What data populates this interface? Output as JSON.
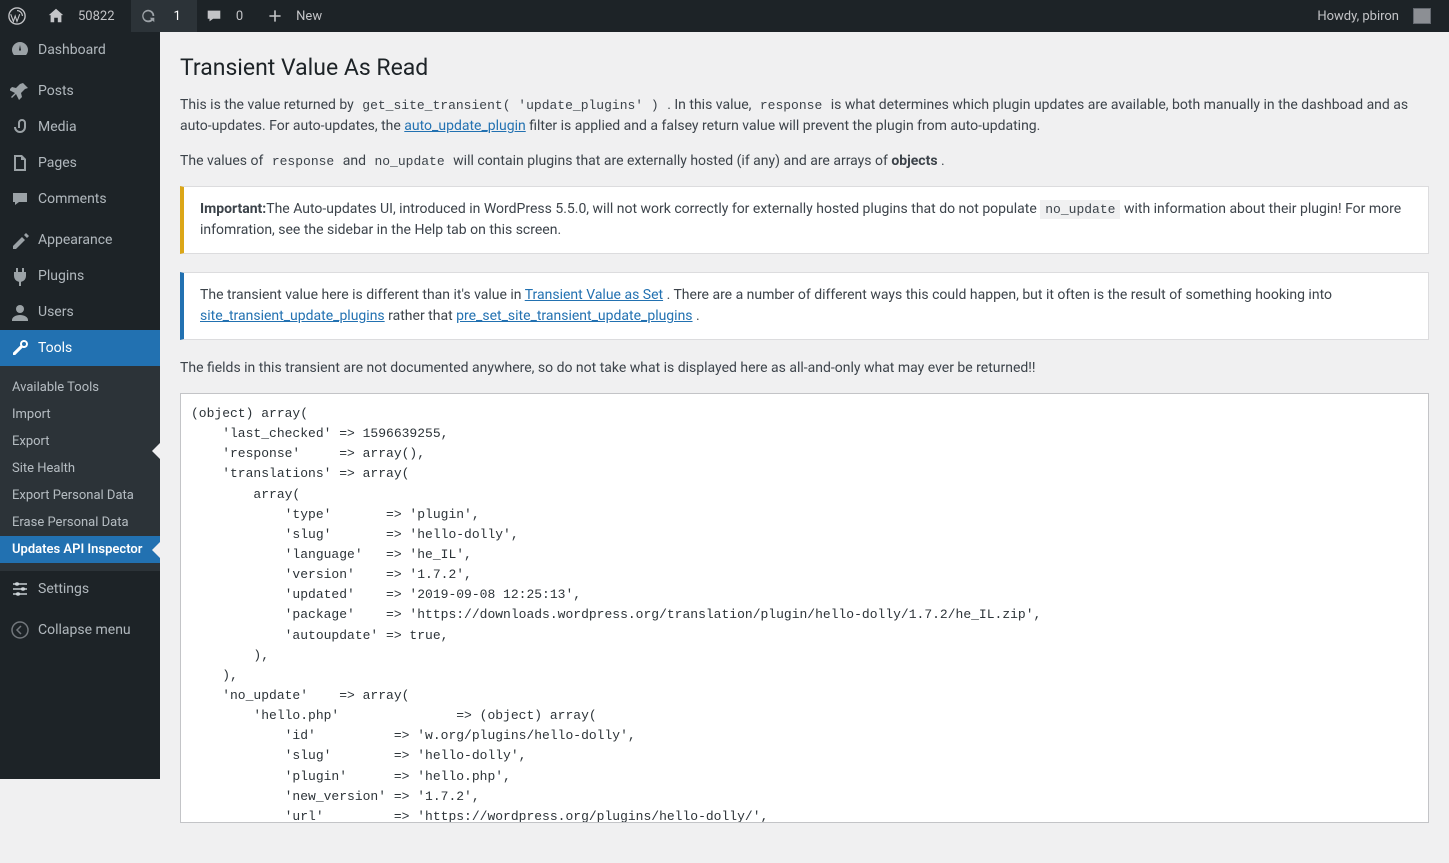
{
  "adminbar": {
    "site_name": "50822",
    "updates_count": "1",
    "comments_count": "0",
    "new_label": "New",
    "howdy": "Howdy, pbiron"
  },
  "sidebar": {
    "items": [
      {
        "id": "dashboard",
        "label": "Dashboard"
      },
      {
        "id": "posts",
        "label": "Posts"
      },
      {
        "id": "media",
        "label": "Media"
      },
      {
        "id": "pages",
        "label": "Pages"
      },
      {
        "id": "comments",
        "label": "Comments"
      },
      {
        "id": "appearance",
        "label": "Appearance"
      },
      {
        "id": "plugins",
        "label": "Plugins"
      },
      {
        "id": "users",
        "label": "Users"
      },
      {
        "id": "tools",
        "label": "Tools"
      },
      {
        "id": "settings",
        "label": "Settings"
      }
    ],
    "tools_sub": [
      {
        "label": "Available Tools"
      },
      {
        "label": "Import"
      },
      {
        "label": "Export"
      },
      {
        "label": "Site Health"
      },
      {
        "label": "Export Personal Data"
      },
      {
        "label": "Erase Personal Data"
      },
      {
        "label": "Updates API Inspector"
      }
    ],
    "collapse": "Collapse menu"
  },
  "page": {
    "title": "Transient Value As Read",
    "intro_1a": "This is the value returned by ",
    "intro_code1": "get_site_transient( 'update_plugins' )",
    "intro_1b": ".  In this value, ",
    "intro_code2": "response",
    "intro_1c": " is what determines which plugin updates are available, both manually in the dashboad and as auto-updates.  For auto-updates, the ",
    "intro_link1": "auto_update_plugin",
    "intro_1d": " filter is applied and a falsey return value will prevent the plugin from auto-updating.",
    "intro_2a": "The values of ",
    "intro_code3": "response",
    "intro_2b": " and ",
    "intro_code4": "no_update",
    "intro_2c": " will contain plugins that are externally hosted (if any) and are arrays of ",
    "intro_bold1": "objects",
    "intro_2d": ".",
    "notice1_bold": "Important:",
    "notice1_a": "The Auto-updates UI, introduced in WordPress 5.5.0, will not work correctly for externally hosted plugins that do not populate ",
    "notice1_code": "no_update",
    "notice1_b": " with information about their plugin!  For more infomration, see the sidebar in the Help tab on this screen.",
    "notice2_a": "The transient value here is different than it's value in ",
    "notice2_link1": "Transient Value as Set",
    "notice2_b": ".  There are a number of different ways this could happen, but it often is the result of something hooking into ",
    "notice2_link2": "site_transient_update_plugins",
    "notice2_c": " rather that ",
    "notice2_link3": "pre_set_site_transient_update_plugins",
    "notice2_d": ".",
    "disclaimer": "The fields in this transient are not documented anywhere, so do not take what is displayed here as all-and-only what may ever be returned!!",
    "code": "(object) array(\n    'last_checked' => 1596639255,\n    'response'     => array(),\n    'translations' => array(\n        array(\n            'type'       => 'plugin',\n            'slug'       => 'hello-dolly',\n            'language'   => 'he_IL',\n            'version'    => '1.7.2',\n            'updated'    => '2019-09-08 12:25:13',\n            'package'    => 'https://downloads.wordpress.org/translation/plugin/hello-dolly/1.7.2/he_IL.zip',\n            'autoupdate' => true,\n        ),\n    ),\n    'no_update'    => array(\n        'hello.php'               => (object) array(\n            'id'          => 'w.org/plugins/hello-dolly',\n            'slug'        => 'hello-dolly',\n            'plugin'      => 'hello.php',\n            'new_version' => '1.7.2',\n            'url'         => 'https://wordpress.org/plugins/hello-dolly/',"
  }
}
